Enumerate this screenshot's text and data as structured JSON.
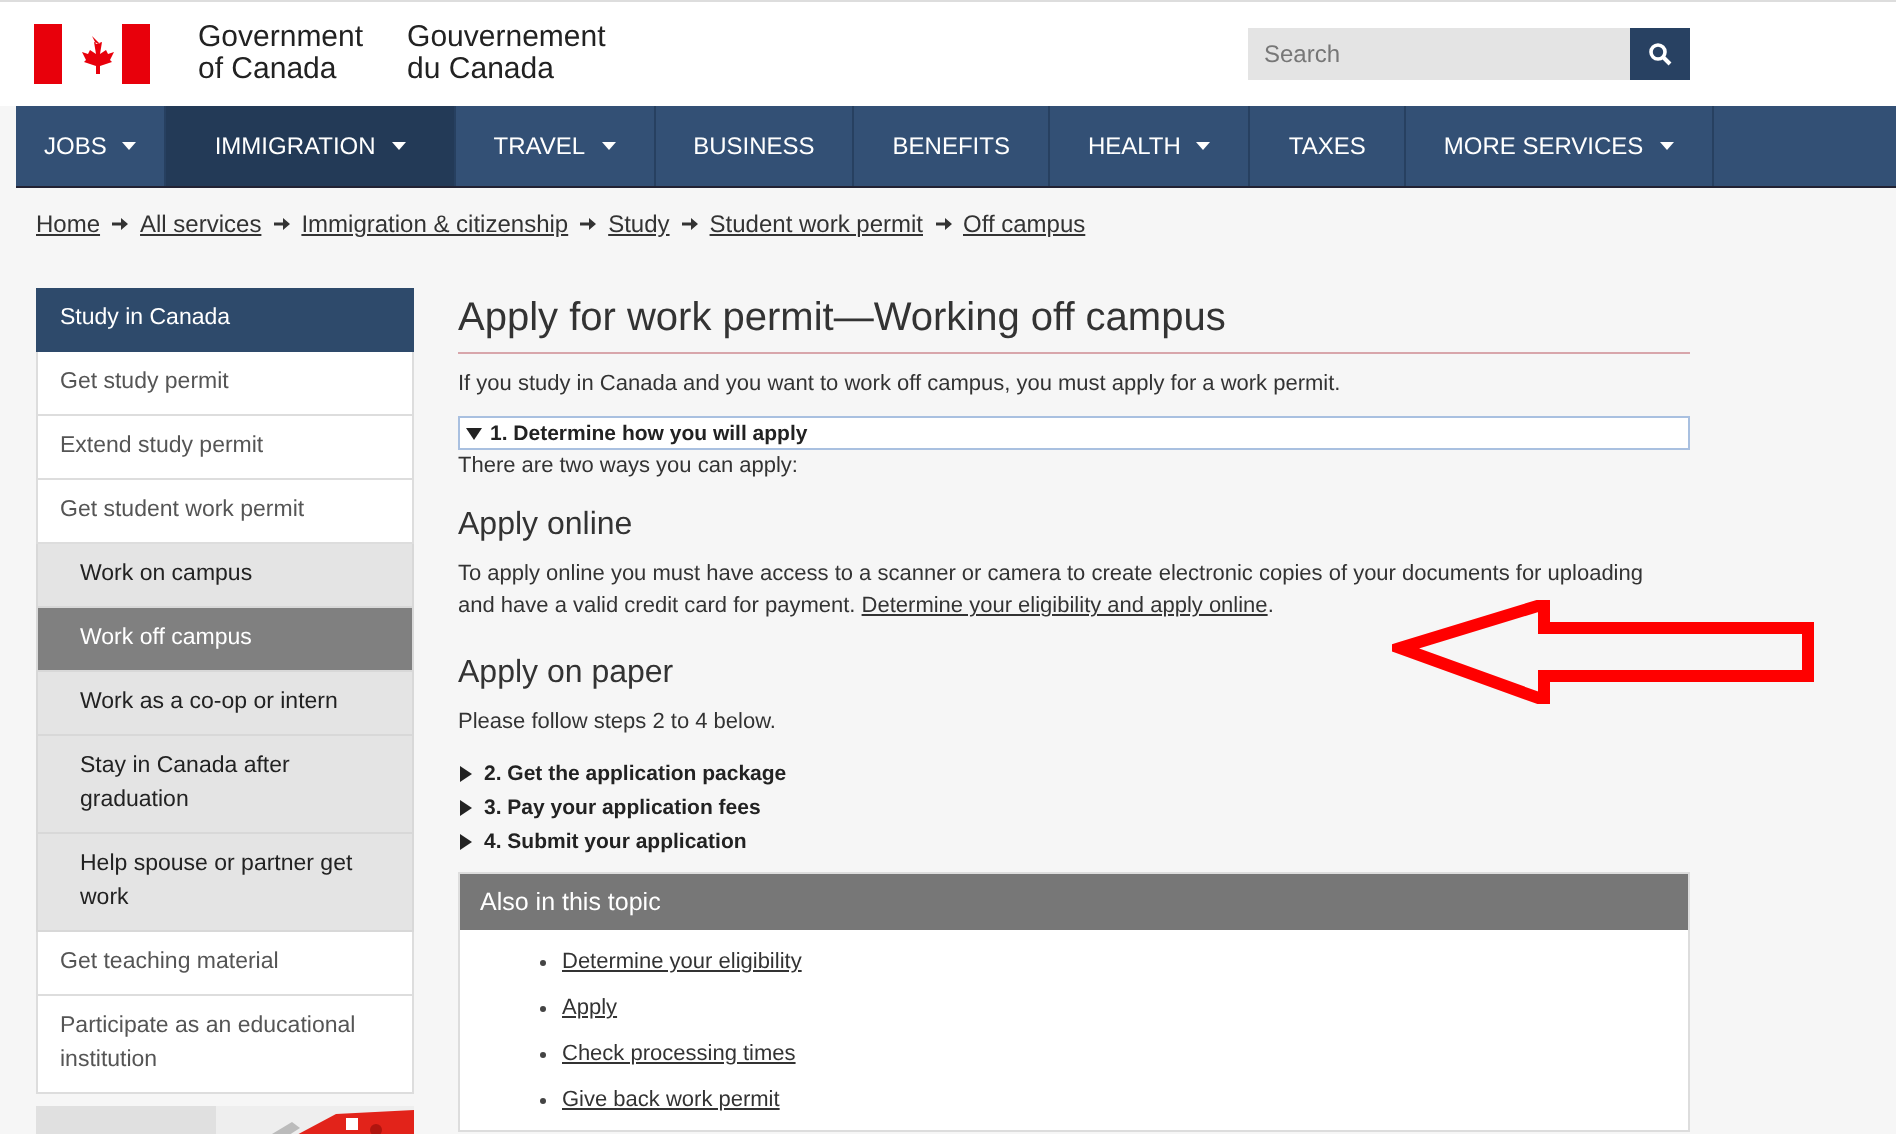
{
  "header": {
    "name_en": [
      "Government",
      "of Canada"
    ],
    "name_fr": [
      "Gouvernement",
      "du Canada"
    ],
    "search": {
      "placeholder": "Search"
    }
  },
  "nav": [
    {
      "label": "JOBS",
      "dropdown": true,
      "selected": false
    },
    {
      "label": "IMMIGRATION",
      "dropdown": true,
      "selected": true
    },
    {
      "label": "TRAVEL",
      "dropdown": true,
      "selected": false
    },
    {
      "label": "BUSINESS",
      "dropdown": false,
      "selected": false
    },
    {
      "label": "BENEFITS",
      "dropdown": false,
      "selected": false
    },
    {
      "label": "HEALTH",
      "dropdown": true,
      "selected": false
    },
    {
      "label": "TAXES",
      "dropdown": false,
      "selected": false
    },
    {
      "label": "MORE SERVICES",
      "dropdown": true,
      "selected": false
    }
  ],
  "breadcrumb": [
    "Home",
    "All services",
    "Immigration & citizenship",
    "Study",
    "Student work permit",
    "Off campus"
  ],
  "sidebar": {
    "items": [
      {
        "label": "Study in Canada",
        "kind": "heading",
        "selected": false
      },
      {
        "label": "Get study permit",
        "kind": "item",
        "selected": false
      },
      {
        "label": "Extend study permit",
        "kind": "item",
        "selected": false
      },
      {
        "label": "Get student work permit",
        "kind": "item",
        "selected": false
      },
      {
        "label": "Work on campus",
        "kind": "subitem",
        "selected": false
      },
      {
        "label": "Work off campus",
        "kind": "subitem",
        "selected": true
      },
      {
        "label": "Work as a co-op or intern",
        "kind": "subitem",
        "selected": false
      },
      {
        "label": "Stay in Canada after graduation",
        "kind": "subitem",
        "selected": false
      },
      {
        "label": "Help spouse or partner get work",
        "kind": "subitem",
        "selected": false
      },
      {
        "label": "Get teaching material",
        "kind": "item",
        "selected": false
      },
      {
        "label": "Participate as an educational institution",
        "kind": "item",
        "selected": false
      }
    ]
  },
  "main": {
    "title": "Apply for work permit—Working off campus",
    "intro": "If you study in Canada and you want to work off campus, you must apply for a work permit.",
    "step1": {
      "label": "1. Determine how you will apply",
      "expanded": true,
      "text": "There are two ways you can apply:",
      "online": {
        "heading": "Apply online",
        "text": "To apply online you must have access to a scanner or camera to create electronic copies of your documents for uploading and have a valid credit card for payment.",
        "link": "Determine your eligibility and apply online",
        "after": "."
      },
      "paper": {
        "heading": "Apply on paper",
        "text": "Please follow steps 2 to 4 below."
      }
    },
    "steps": [
      {
        "label": "2. Get the application package",
        "expanded": false
      },
      {
        "label": "3. Pay your application fees",
        "expanded": false
      },
      {
        "label": "4. Submit your application",
        "expanded": false
      }
    ],
    "also": {
      "title": "Also in this topic",
      "links": [
        "Determine your eligibility",
        "Apply",
        "Check processing times",
        "Give back work permit"
      ]
    }
  }
}
